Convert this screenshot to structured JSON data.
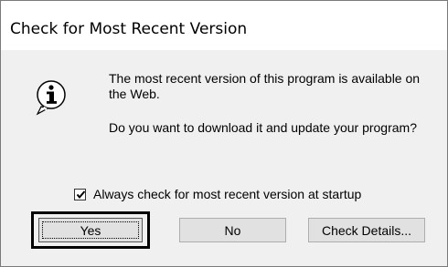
{
  "window": {
    "title": "Check for Most Recent Version"
  },
  "message": {
    "icon": "info-icon",
    "line1": "The most recent version of this program is available on the Web.",
    "line2": "Do you want to download it and update your program?"
  },
  "option": {
    "checked": true,
    "label": "Always check for most recent version at startup"
  },
  "buttons": {
    "yes": "Yes",
    "no": "No",
    "details": "Check Details..."
  },
  "colors": {
    "client_background": "#f0f0f0",
    "button_face": "#e1e1e1",
    "highlight_outline": "#000000"
  }
}
